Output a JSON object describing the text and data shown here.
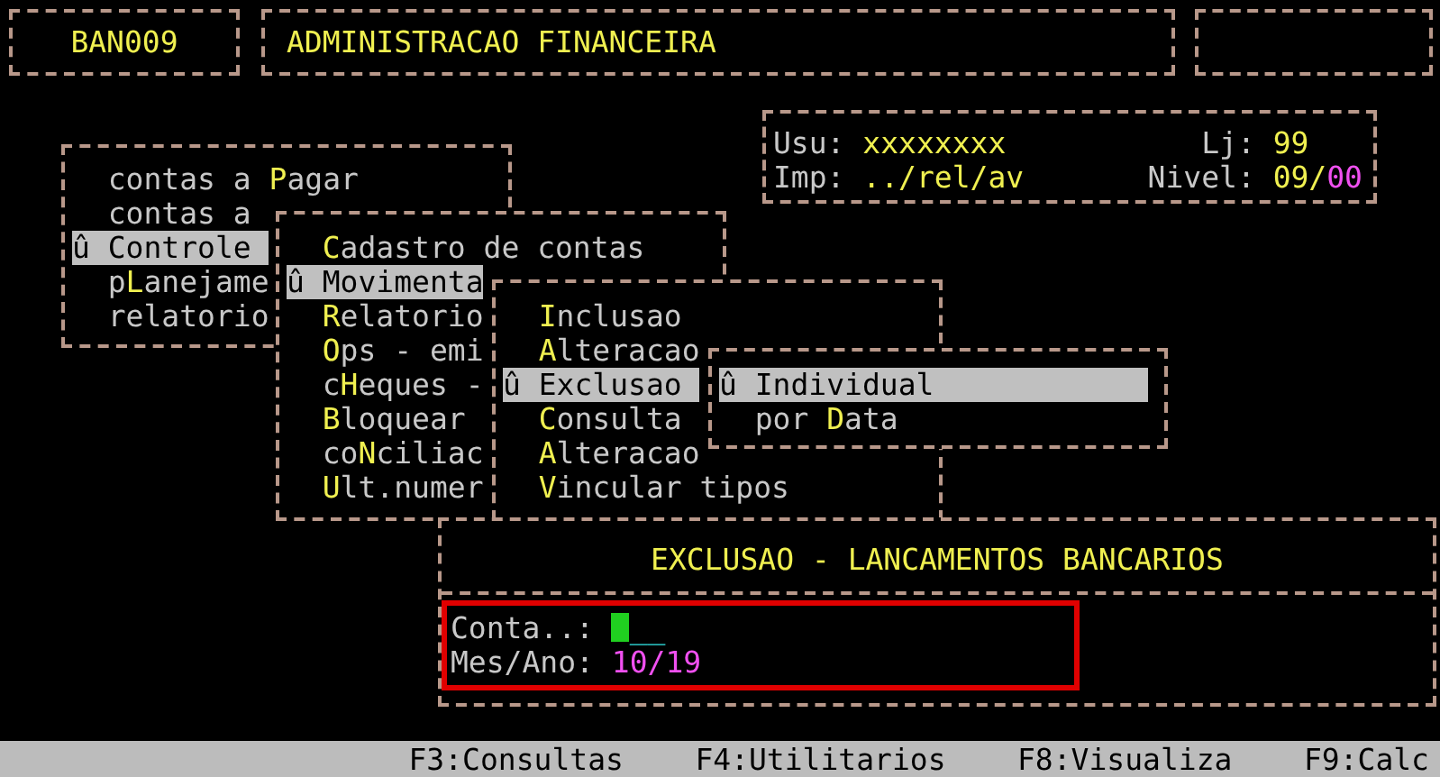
{
  "header": {
    "program_code": "BAN009",
    "system_title": "ADMINISTRACAO FINANCEIRA"
  },
  "session": {
    "user_label": "Usu:",
    "user": "xxxxxxxx",
    "store_label": "Lj:",
    "store": "99",
    "printer_label": "Imp:",
    "printer": "../rel/av",
    "level_label": "Nivel:",
    "level_main": "09/",
    "level_sub": "00"
  },
  "menus": [
    {
      "items": [
        {
          "label": "contas a **P**agar",
          "selected": false
        },
        {
          "label": "contas a",
          "selected": false
        },
        {
          "label": "û Controle",
          "selected": true
        },
        {
          "label": "p**L**anejame",
          "selected": false
        },
        {
          "label": "relatorio",
          "selected": false
        }
      ]
    },
    {
      "items": [
        {
          "label": "**C**adastro de contas",
          "selected": false
        },
        {
          "label": "û Movimenta",
          "selected": true
        },
        {
          "label": "**R**elatorio",
          "selected": false
        },
        {
          "label": "**O**ps - emi",
          "selected": false
        },
        {
          "label": "c**H**eques -",
          "selected": false
        },
        {
          "label": "**B**loquear",
          "selected": false
        },
        {
          "label": "co**N**ciliac",
          "selected": false
        },
        {
          "label": "**U**lt.numer",
          "selected": false
        }
      ]
    },
    {
      "items": [
        {
          "label": "**I**nclusao",
          "selected": false
        },
        {
          "label": "**A**lteracao",
          "selected": false
        },
        {
          "label": "û Exclusao",
          "selected": true
        },
        {
          "label": "**C**onsulta",
          "selected": false
        },
        {
          "label": "**A**lteracao",
          "selected": false
        },
        {
          "label": "**V**incular tipos",
          "selected": false
        }
      ]
    },
    {
      "items": [
        {
          "label": "û Individual",
          "selected": true
        },
        {
          "label": "por **D**ata",
          "selected": false
        }
      ]
    }
  ],
  "form": {
    "title": "EXCLUSAO - LANCAMENTOS BANCARIOS",
    "fields": [
      {
        "kind": "input",
        "label": "Conta..:",
        "fill": "__"
      },
      {
        "kind": "value",
        "label": "Mes/Ano:",
        "value": "10/19"
      }
    ]
  },
  "status_bar": [
    "F3:Consultas",
    "F4:Utilitarios",
    "F8:Visualiza",
    "F9:Calc"
  ]
}
